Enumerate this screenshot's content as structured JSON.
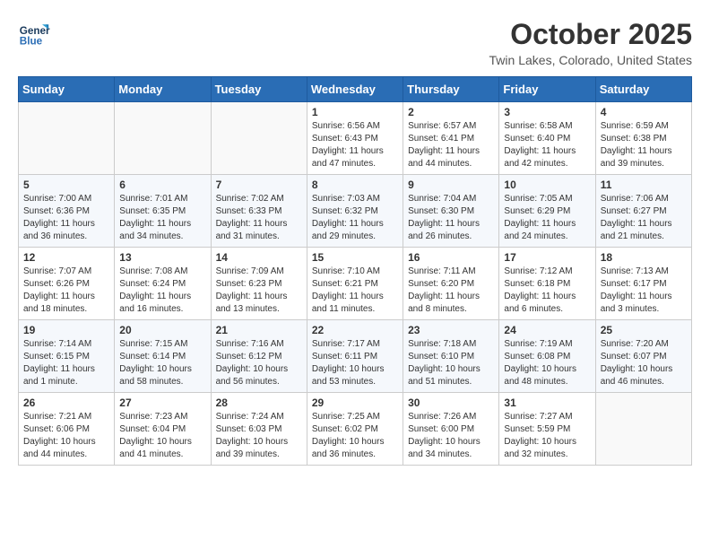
{
  "header": {
    "logo_line1": "General",
    "logo_line2": "Blue",
    "month_title": "October 2025",
    "location": "Twin Lakes, Colorado, United States"
  },
  "days_of_week": [
    "Sunday",
    "Monday",
    "Tuesday",
    "Wednesday",
    "Thursday",
    "Friday",
    "Saturday"
  ],
  "weeks": [
    [
      {
        "day": "",
        "info": ""
      },
      {
        "day": "",
        "info": ""
      },
      {
        "day": "",
        "info": ""
      },
      {
        "day": "1",
        "info": "Sunrise: 6:56 AM\nSunset: 6:43 PM\nDaylight: 11 hours and 47 minutes."
      },
      {
        "day": "2",
        "info": "Sunrise: 6:57 AM\nSunset: 6:41 PM\nDaylight: 11 hours and 44 minutes."
      },
      {
        "day": "3",
        "info": "Sunrise: 6:58 AM\nSunset: 6:40 PM\nDaylight: 11 hours and 42 minutes."
      },
      {
        "day": "4",
        "info": "Sunrise: 6:59 AM\nSunset: 6:38 PM\nDaylight: 11 hours and 39 minutes."
      }
    ],
    [
      {
        "day": "5",
        "info": "Sunrise: 7:00 AM\nSunset: 6:36 PM\nDaylight: 11 hours and 36 minutes."
      },
      {
        "day": "6",
        "info": "Sunrise: 7:01 AM\nSunset: 6:35 PM\nDaylight: 11 hours and 34 minutes."
      },
      {
        "day": "7",
        "info": "Sunrise: 7:02 AM\nSunset: 6:33 PM\nDaylight: 11 hours and 31 minutes."
      },
      {
        "day": "8",
        "info": "Sunrise: 7:03 AM\nSunset: 6:32 PM\nDaylight: 11 hours and 29 minutes."
      },
      {
        "day": "9",
        "info": "Sunrise: 7:04 AM\nSunset: 6:30 PM\nDaylight: 11 hours and 26 minutes."
      },
      {
        "day": "10",
        "info": "Sunrise: 7:05 AM\nSunset: 6:29 PM\nDaylight: 11 hours and 24 minutes."
      },
      {
        "day": "11",
        "info": "Sunrise: 7:06 AM\nSunset: 6:27 PM\nDaylight: 11 hours and 21 minutes."
      }
    ],
    [
      {
        "day": "12",
        "info": "Sunrise: 7:07 AM\nSunset: 6:26 PM\nDaylight: 11 hours and 18 minutes."
      },
      {
        "day": "13",
        "info": "Sunrise: 7:08 AM\nSunset: 6:24 PM\nDaylight: 11 hours and 16 minutes."
      },
      {
        "day": "14",
        "info": "Sunrise: 7:09 AM\nSunset: 6:23 PM\nDaylight: 11 hours and 13 minutes."
      },
      {
        "day": "15",
        "info": "Sunrise: 7:10 AM\nSunset: 6:21 PM\nDaylight: 11 hours and 11 minutes."
      },
      {
        "day": "16",
        "info": "Sunrise: 7:11 AM\nSunset: 6:20 PM\nDaylight: 11 hours and 8 minutes."
      },
      {
        "day": "17",
        "info": "Sunrise: 7:12 AM\nSunset: 6:18 PM\nDaylight: 11 hours and 6 minutes."
      },
      {
        "day": "18",
        "info": "Sunrise: 7:13 AM\nSunset: 6:17 PM\nDaylight: 11 hours and 3 minutes."
      }
    ],
    [
      {
        "day": "19",
        "info": "Sunrise: 7:14 AM\nSunset: 6:15 PM\nDaylight: 11 hours and 1 minute."
      },
      {
        "day": "20",
        "info": "Sunrise: 7:15 AM\nSunset: 6:14 PM\nDaylight: 10 hours and 58 minutes."
      },
      {
        "day": "21",
        "info": "Sunrise: 7:16 AM\nSunset: 6:12 PM\nDaylight: 10 hours and 56 minutes."
      },
      {
        "day": "22",
        "info": "Sunrise: 7:17 AM\nSunset: 6:11 PM\nDaylight: 10 hours and 53 minutes."
      },
      {
        "day": "23",
        "info": "Sunrise: 7:18 AM\nSunset: 6:10 PM\nDaylight: 10 hours and 51 minutes."
      },
      {
        "day": "24",
        "info": "Sunrise: 7:19 AM\nSunset: 6:08 PM\nDaylight: 10 hours and 48 minutes."
      },
      {
        "day": "25",
        "info": "Sunrise: 7:20 AM\nSunset: 6:07 PM\nDaylight: 10 hours and 46 minutes."
      }
    ],
    [
      {
        "day": "26",
        "info": "Sunrise: 7:21 AM\nSunset: 6:06 PM\nDaylight: 10 hours and 44 minutes."
      },
      {
        "day": "27",
        "info": "Sunrise: 7:23 AM\nSunset: 6:04 PM\nDaylight: 10 hours and 41 minutes."
      },
      {
        "day": "28",
        "info": "Sunrise: 7:24 AM\nSunset: 6:03 PM\nDaylight: 10 hours and 39 minutes."
      },
      {
        "day": "29",
        "info": "Sunrise: 7:25 AM\nSunset: 6:02 PM\nDaylight: 10 hours and 36 minutes."
      },
      {
        "day": "30",
        "info": "Sunrise: 7:26 AM\nSunset: 6:00 PM\nDaylight: 10 hours and 34 minutes."
      },
      {
        "day": "31",
        "info": "Sunrise: 7:27 AM\nSunset: 5:59 PM\nDaylight: 10 hours and 32 minutes."
      },
      {
        "day": "",
        "info": ""
      }
    ]
  ]
}
